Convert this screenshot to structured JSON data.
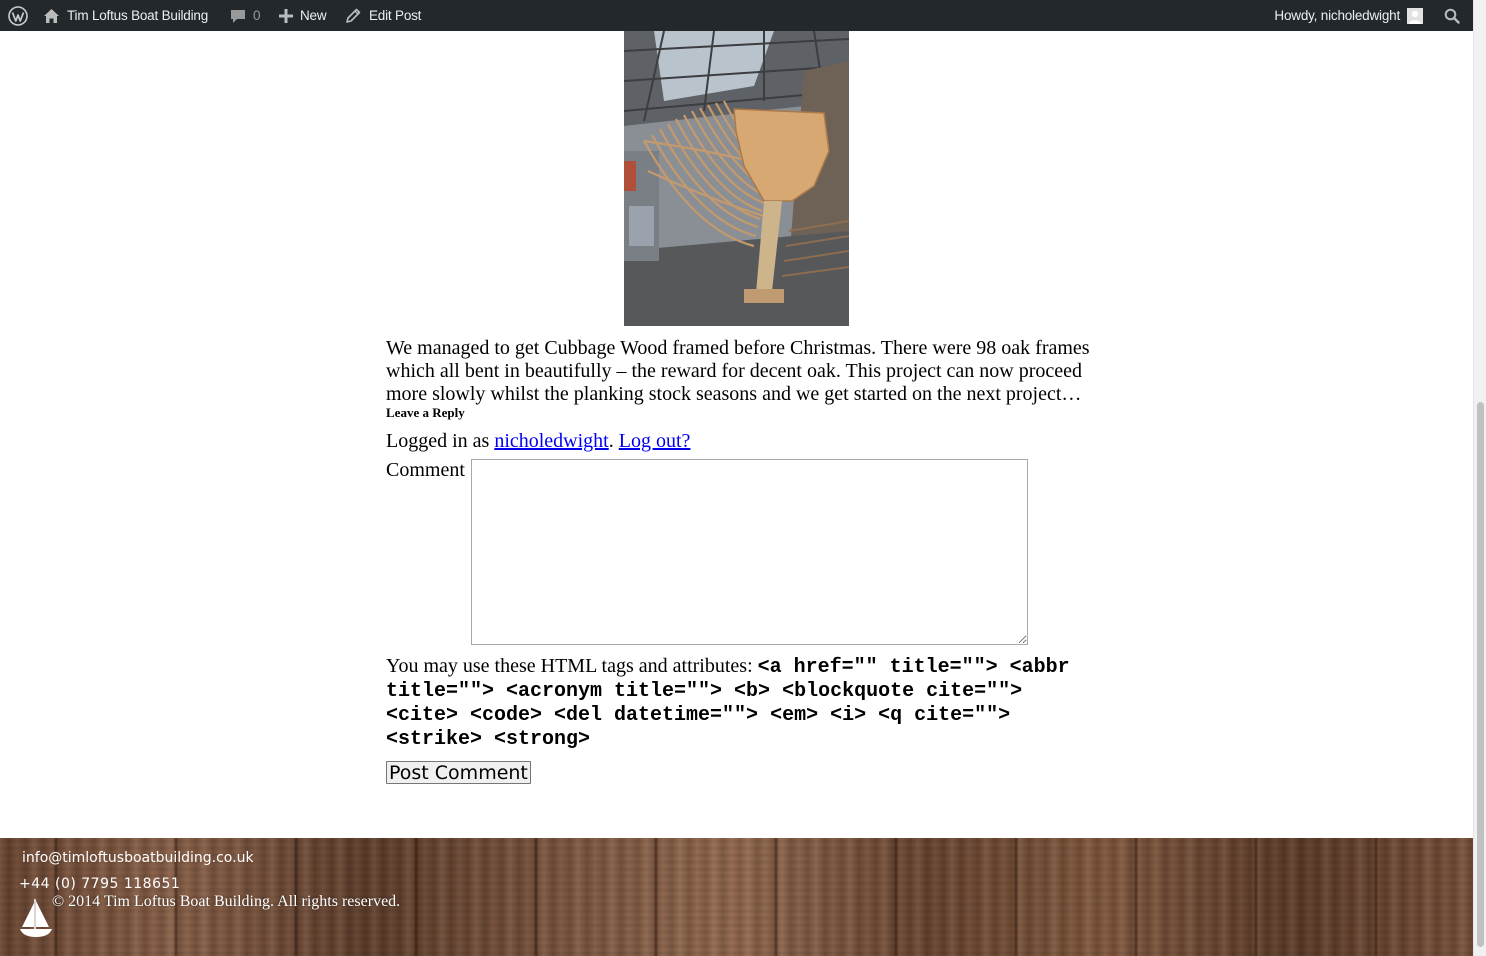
{
  "admin_bar": {
    "wp_logo_icon": "wordpress-logo-icon",
    "site_name": "Tim Loftus Boat Building",
    "comments_count": "0",
    "new_label": "New",
    "edit_label": "Edit Post",
    "howdy": "Howdy, nicholedwight",
    "colors": {
      "background": "#23282d",
      "text": "#eeeeee"
    }
  },
  "post": {
    "image_alt": "Oak frames of Cubbage Wood in the boat shed",
    "text": "We managed to get Cubbage Wood framed before Christmas. There were 98 oak frames which all bent in beautifully – the reward for decent oak. This project can now proceed more slowly whilst the planking stock seasons and we get started on the next project…"
  },
  "reply": {
    "title": "Leave a Reply",
    "logged_in_prefix": "Logged in as ",
    "username": "nicholedwight",
    "separator": ". ",
    "logout": "Log out?",
    "comment_label": "Comment",
    "comment_value": "",
    "allowed_prefix": "You may use these HTML tags and attributes: ",
    "allowed_tags": "<a href=\"\" title=\"\"> <abbr title=\"\"> <acronym title=\"\"> <b> <blockquote cite=\"\"> <cite> <code> <del datetime=\"\"> <em> <i> <q cite=\"\"> <strike> <strong>",
    "submit": "Post Comment",
    "link_color": "#0000ee"
  },
  "footer": {
    "email": "info@timloftusboatbuilding.co.uk",
    "phone": "+44 (0) 7795 118651",
    "copyright": "© 2014 Tim Loftus Boat Building. All rights reserved.",
    "logo_icon": "sailboat-logo-icon"
  }
}
